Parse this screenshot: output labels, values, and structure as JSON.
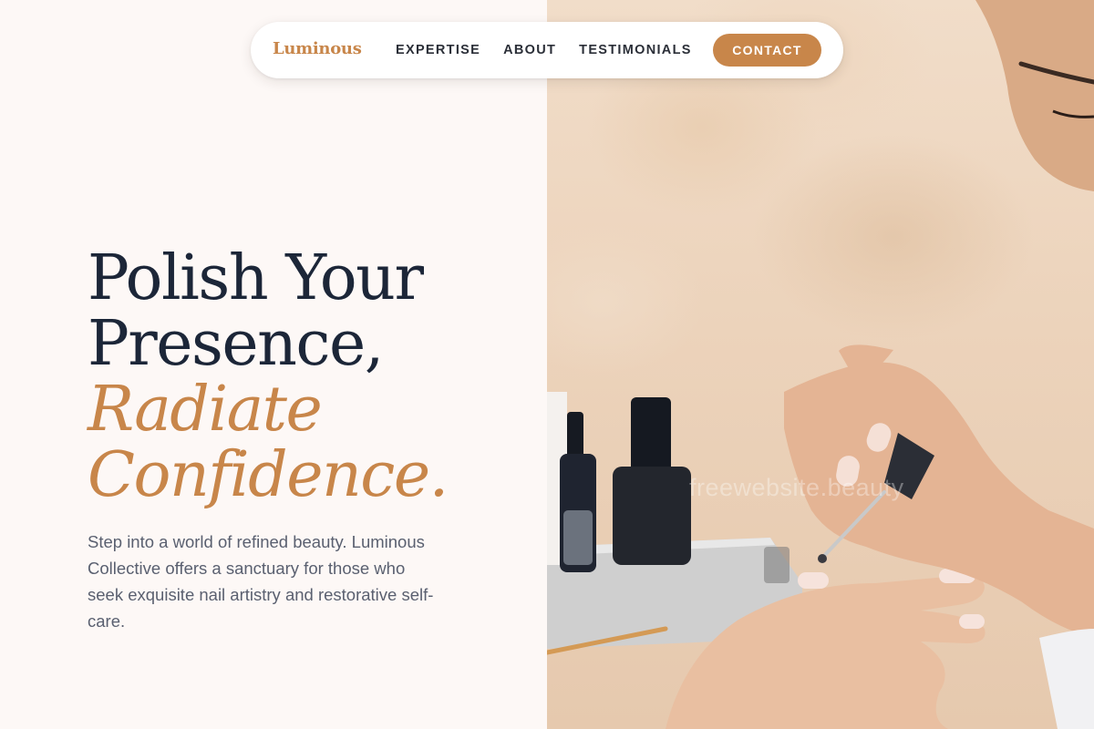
{
  "nav": {
    "brand": "Luminous",
    "links": [
      "EXPERTISE",
      "ABOUT",
      "TESTIMONIALS"
    ],
    "cta_label": "CONTACT"
  },
  "hero": {
    "headline_line1": "Polish Your",
    "headline_line2": "Presence,",
    "headline_accent_line1": "Radiate",
    "headline_accent_line2": "Confidence.",
    "subcopy": "Step into a world of refined beauty. Luminous Collective offers a sanctuary for those who seek exquisite nail artistry and restorative self-care."
  },
  "photo": {
    "subject": "manicurist applying nail polish to a client's nails",
    "watermark": "freewebsite.beauty"
  },
  "colors": {
    "accent": "#c8864a",
    "heading": "#1c2638",
    "body_text": "#5a6070",
    "background": "#fdf8f6",
    "nav_background": "#ffffff"
  }
}
